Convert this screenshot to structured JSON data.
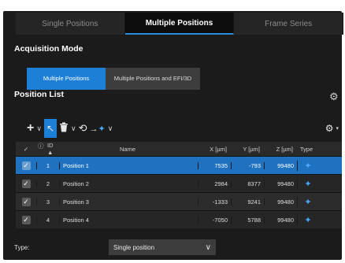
{
  "tabs": [
    {
      "label": "Single Positions",
      "active": false
    },
    {
      "label": "Multiple Positions",
      "active": true
    },
    {
      "label": "Frame Series",
      "active": false
    }
  ],
  "acquisition_mode": {
    "title": "Acquisition Mode",
    "options": [
      {
        "label": "Multiple Positions",
        "active": true
      },
      {
        "label": "Multiple Positions and EFI/3D",
        "active": false
      }
    ]
  },
  "position_list": {
    "title": "Position List",
    "settings_icon": "gear-icon",
    "toolbar": [
      {
        "icon": "plus-icon",
        "glyph": "+",
        "dropdown": true
      },
      {
        "icon": "cursor-select-icon",
        "glyph": "↖",
        "dropdown": false,
        "selected": true
      },
      {
        "icon": "trash-icon",
        "glyph": "🗑",
        "dropdown": true
      },
      {
        "icon": "refresh-position-icon",
        "glyph": "⟲",
        "dropdown": false
      },
      {
        "icon": "move-to-icon",
        "glyph": "→",
        "dropdown": true
      }
    ],
    "toolbar_right_icon": "gear-dropdown-icon",
    "columns": {
      "check": "✓",
      "info": "ⓘ",
      "id": "ID ▲",
      "name": "Name",
      "x": "X [µm]",
      "y": "Y [µm]",
      "z": "Z [µm]",
      "type": "Type"
    },
    "rows": [
      {
        "checked": true,
        "id": "1",
        "name": "Position 1",
        "x": "7535",
        "y": "-793",
        "z": "99480",
        "selected": true
      },
      {
        "checked": true,
        "id": "2",
        "name": "Position 2",
        "x": "2984",
        "y": "8377",
        "z": "99480",
        "selected": false
      },
      {
        "checked": true,
        "id": "3",
        "name": "Position 3",
        "x": "-1333",
        "y": "9241",
        "z": "99480",
        "selected": false
      },
      {
        "checked": true,
        "id": "4",
        "name": "Position 4",
        "x": "-7050",
        "y": "5788",
        "z": "99480",
        "selected": false
      }
    ]
  },
  "type_field": {
    "label": "Type:",
    "value": "Single position"
  },
  "colors": {
    "accent": "#1e7fd6",
    "selected_row": "#1e72c0",
    "background": "#1b1b1b"
  }
}
